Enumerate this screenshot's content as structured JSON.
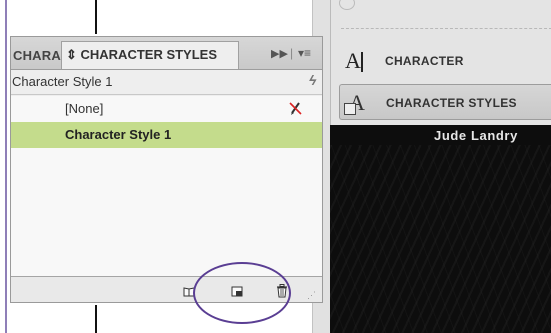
{
  "panel": {
    "tab_character": "CHARACTER",
    "tab_character_styles": "⇕ CHARACTER STYLES",
    "current_style": "Character Style 1",
    "items": [
      {
        "label": "[None]"
      },
      {
        "label": "Character Style 1"
      }
    ]
  },
  "right_panel": {
    "character_label": "CHARACTER",
    "character_styles_label": "CHARACTER STYLES",
    "author": "Jude Landry"
  },
  "colors": {
    "selected_row": "#c4dc8c",
    "highlight_circle": "#5a3e93",
    "guide_line": "#8f7fb8"
  },
  "icons": [
    "panel-menu-icon",
    "lightning-icon",
    "no-edit-pencil-icon",
    "load-styles-icon",
    "new-style-icon",
    "trash-icon",
    "resize-grip-icon",
    "character-icon",
    "character-styles-icon"
  ]
}
